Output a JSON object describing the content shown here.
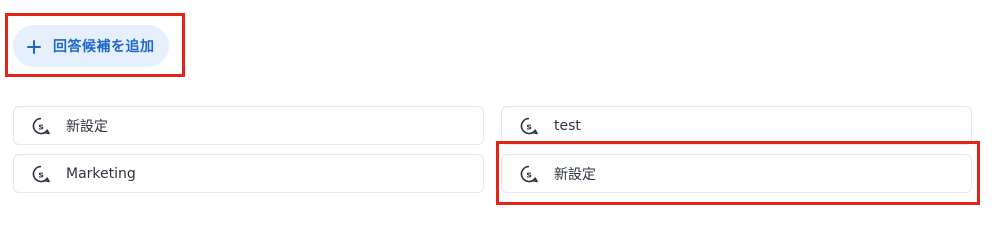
{
  "actions": {
    "add_candidate_label": "回答候補を追加",
    "add_icon": "plus-icon"
  },
  "candidates": [
    {
      "label": "新設定",
      "icon": "chat-bubble-icon"
    },
    {
      "label": "test",
      "icon": "chat-bubble-icon"
    },
    {
      "label": "Marketing",
      "icon": "chat-bubble-icon"
    },
    {
      "label": "新設定",
      "icon": "chat-bubble-icon"
    }
  ],
  "colors": {
    "accent": "#1f66c9",
    "accent_bg": "#e6f0fc",
    "highlight": "#e3241b",
    "item_border": "#e3e6ea",
    "text": "#2b3340"
  }
}
